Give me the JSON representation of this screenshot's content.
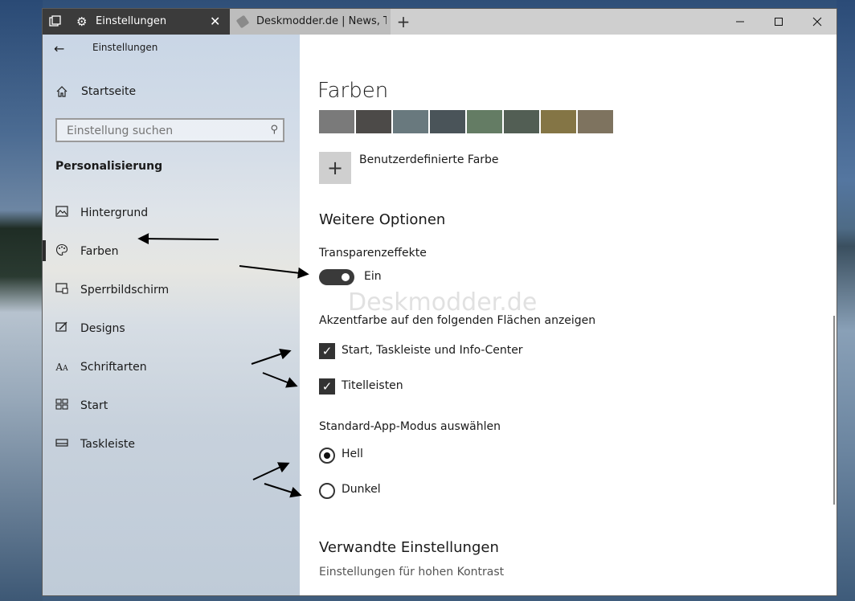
{
  "tabs": {
    "active_title": "Einstellungen",
    "inactive_title": "Deskmodder.de | News, Tip"
  },
  "icons": {
    "tab_manager": "tab-manager-icon",
    "settings": "gear-icon",
    "close": "close-icon",
    "new_tab": "plus-icon",
    "minimize": "minimize-icon",
    "maximize": "maximize-icon",
    "back": "back-arrow-icon",
    "home": "home-icon",
    "search": "search-icon"
  },
  "sidebar": {
    "title": "Einstellungen",
    "home": "Startseite",
    "search_placeholder": "Einstellung suchen",
    "section": "Personalisierung",
    "items": [
      {
        "label": "Hintergrund",
        "icon": "picture-icon"
      },
      {
        "label": "Farben",
        "icon": "palette-icon"
      },
      {
        "label": "Sperrbildschirm",
        "icon": "lock-screen-icon"
      },
      {
        "label": "Designs",
        "icon": "themes-icon"
      },
      {
        "label": "Schriftarten",
        "icon": "fonts-icon"
      },
      {
        "label": "Start",
        "icon": "start-icon"
      },
      {
        "label": "Taskleiste",
        "icon": "taskbar-icon"
      }
    ]
  },
  "main": {
    "title": "Farben",
    "swatches": [
      "#7a7a7a",
      "#4c4a48",
      "#69797e",
      "#4a5459",
      "#647c64",
      "#525e54",
      "#847545",
      "#7e735f"
    ],
    "custom_color": "Benutzerdefinierte Farbe",
    "more_options": "Weitere Optionen",
    "transparency_label": "Transparenzeffekte",
    "transparency_state": "Ein",
    "watermark": "Deskmodder.de",
    "accent_label": "Akzentfarbe auf den folgenden Flächen anzeigen",
    "accent_start": "Start, Taskleiste und Info-Center",
    "accent_titlebars": "Titelleisten",
    "app_mode_label": "Standard-App-Modus auswählen",
    "mode_light": "Hell",
    "mode_dark": "Dunkel",
    "related_title": "Verwandte Einstellungen",
    "related_link": "Einstellungen für hohen Kontrast"
  }
}
